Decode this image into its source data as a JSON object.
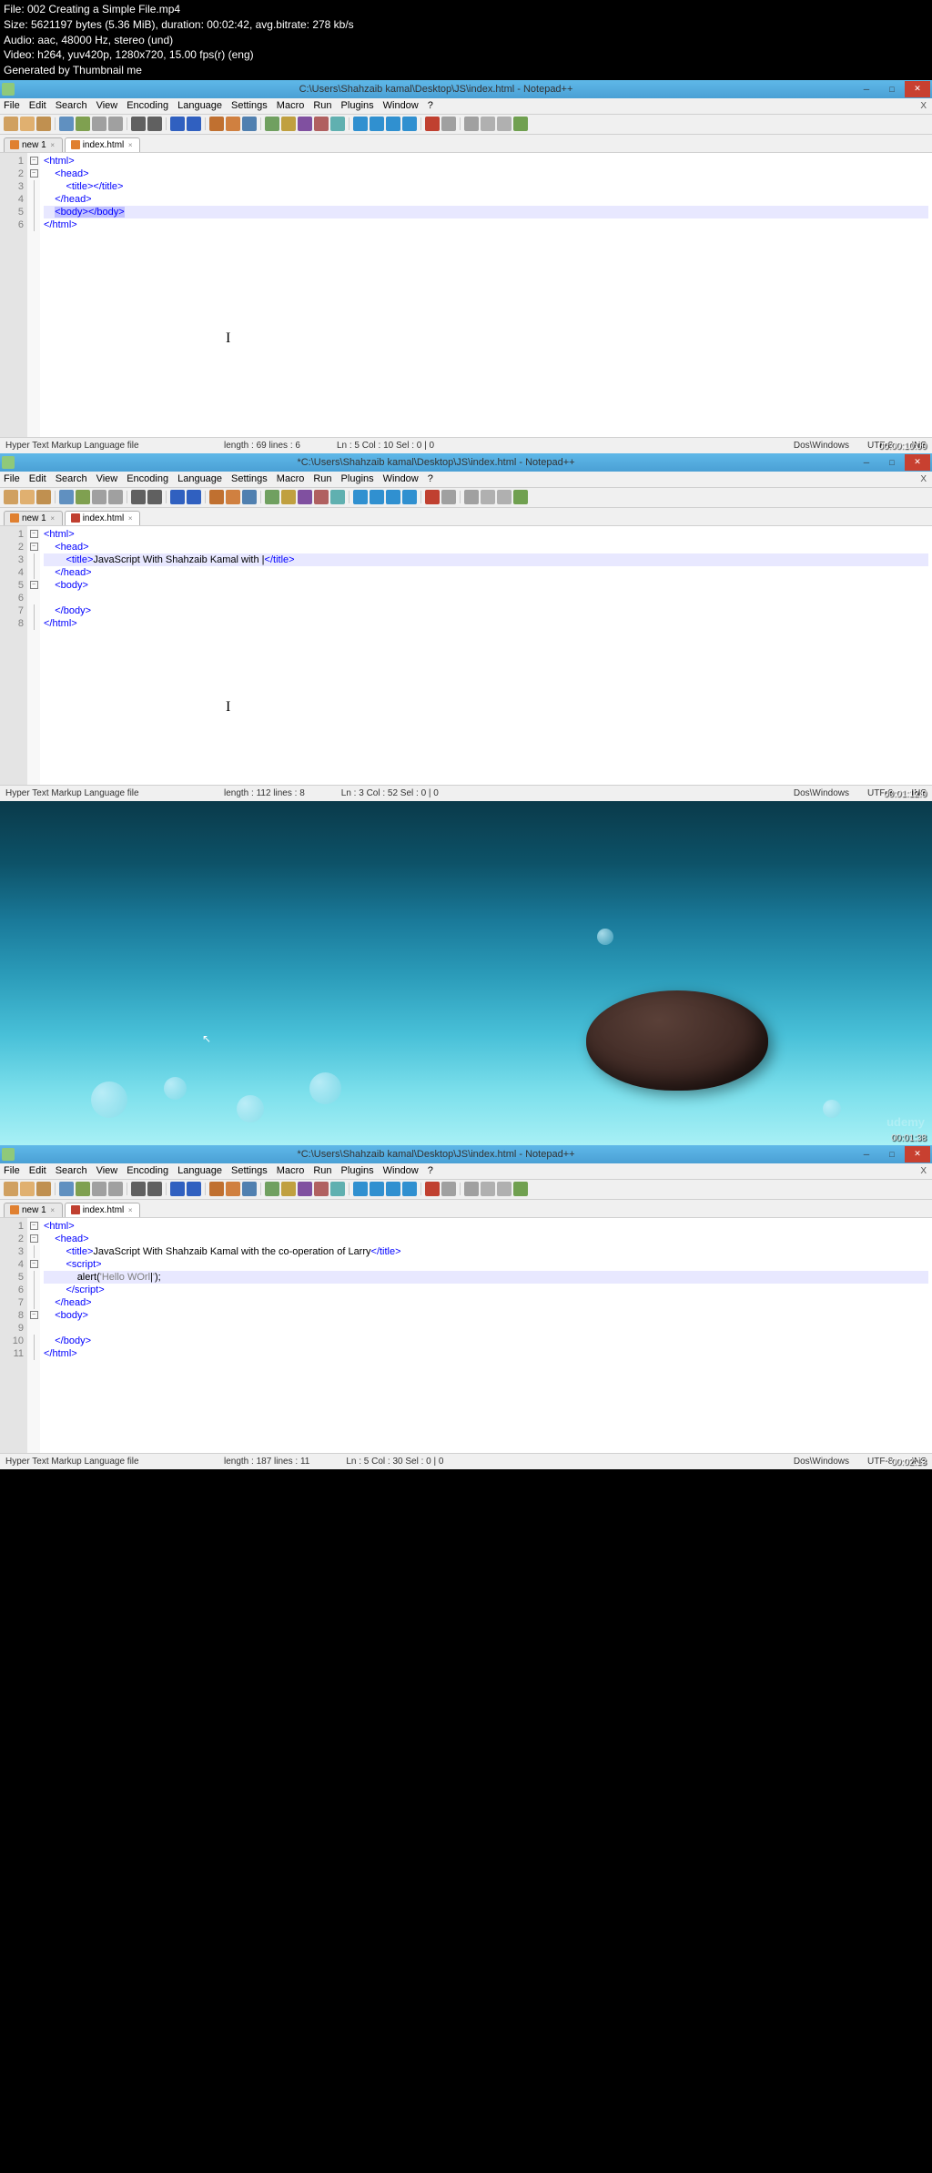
{
  "meta": {
    "file": "File: 002 Creating a Simple File.mp4",
    "size": "Size: 5621197 bytes (5.36 MiB), duration: 00:02:42, avg.bitrate: 278 kb/s",
    "audio": "Audio: aac, 48000 Hz, stereo (und)",
    "video": "Video: h264, yuv420p, 1280x720, 15.00 fps(r) (eng)",
    "gen": "Generated by Thumbnail me"
  },
  "menus": [
    "File",
    "Edit",
    "Search",
    "View",
    "Encoding",
    "Language",
    "Settings",
    "Macro",
    "Run",
    "Plugins",
    "Window",
    "?"
  ],
  "frame1": {
    "title": "C:\\Users\\Shahzaib kamal\\Desktop\\JS\\index.html - Notepad++",
    "tab_new": "new 1",
    "tab_file": "index.html",
    "code": [
      {
        "indent": 0,
        "html": "<span class='tag'>&lt;html&gt;</span>"
      },
      {
        "indent": 1,
        "html": "<span class='tag'>&lt;head&gt;</span>"
      },
      {
        "indent": 2,
        "html": "<span class='tag'>&lt;title&gt;&lt;/title&gt;</span>"
      },
      {
        "indent": 1,
        "html": "<span class='tag'>&lt;/head&gt;</span>"
      },
      {
        "indent": 1,
        "html": "<span class='tag' style='background:#c0c0ff'>&lt;body&gt;</span><span class='tag' style='background:#c0c0ff'>&lt;/body&gt;</span>",
        "hl": true
      },
      {
        "indent": 0,
        "html": "<span class='tag'>&lt;/html&gt;</span>"
      }
    ],
    "status": {
      "type": "Hyper Text Markup Language file",
      "length": "length : 69   lines : 6",
      "pos": "Ln : 5   Col : 10   Sel : 0 | 0",
      "eol": "Dos\\Windows",
      "enc": "UTF-8",
      "mode": "INS"
    },
    "timestamp": "00:00:10:00"
  },
  "frame2": {
    "title": "*C:\\Users\\Shahzaib kamal\\Desktop\\JS\\index.html - Notepad++",
    "tab_new": "new 1",
    "tab_file": "index.html",
    "code": [
      {
        "indent": 0,
        "html": "<span class='tag'>&lt;html&gt;</span>"
      },
      {
        "indent": 1,
        "html": "<span class='tag'>&lt;head&gt;</span>"
      },
      {
        "indent": 2,
        "html": "<span class='tag'>&lt;title&gt;</span><span class='txt'>JavaScript With Shahzaib Kamal with </span>|<span class='tag'>&lt;/title&gt;</span>",
        "hl": true
      },
      {
        "indent": 1,
        "html": "<span class='tag'>&lt;/head&gt;</span>"
      },
      {
        "indent": 1,
        "html": "<span class='tag'>&lt;body&gt;</span>"
      },
      {
        "indent": 0,
        "html": ""
      },
      {
        "indent": 1,
        "html": "<span class='tag'>&lt;/body&gt;</span>"
      },
      {
        "indent": 0,
        "html": "<span class='tag'>&lt;/html&gt;</span>"
      }
    ],
    "status": {
      "type": "Hyper Text Markup Language file",
      "length": "length : 112   lines : 8",
      "pos": "Ln : 3   Col : 52   Sel : 0 | 0",
      "eol": "Dos\\Windows",
      "enc": "UTF-8",
      "mode": "INS"
    },
    "timestamp": "00:01:12:0"
  },
  "frame3": {
    "watermark": "udemy",
    "timestamp": "00:01:38"
  },
  "frame4": {
    "title": "*C:\\Users\\Shahzaib kamal\\Desktop\\JS\\index.html - Notepad++",
    "tab_new": "new 1",
    "tab_file": "index.html",
    "code": [
      {
        "indent": 0,
        "html": "<span class='tag'>&lt;html&gt;</span>"
      },
      {
        "indent": 1,
        "html": "<span class='tag'>&lt;head&gt;</span>"
      },
      {
        "indent": 2,
        "html": "<span class='tag'>&lt;title&gt;</span><span class='txt'>JavaScript With Shahzaib Kamal with the co-operation of Larry</span><span class='tag'>&lt;/title&gt;</span>"
      },
      {
        "indent": 2,
        "html": "<span class='tag'>&lt;script&gt;</span>"
      },
      {
        "indent": 3,
        "html": "<span class='txt'>alert(</span><span class='str'>'Hello WOrl</span>|<span class='str'>'</span><span class='txt'>);</span>",
        "hl": true
      },
      {
        "indent": 2,
        "html": "<span class='tag'>&lt;/script&gt;</span>"
      },
      {
        "indent": 1,
        "html": "<span class='tag'>&lt;/head&gt;</span>"
      },
      {
        "indent": 1,
        "html": "<span class='tag'>&lt;body&gt;</span>"
      },
      {
        "indent": 0,
        "html": ""
      },
      {
        "indent": 1,
        "html": "<span class='tag'>&lt;/body&gt;</span>"
      },
      {
        "indent": 0,
        "html": "<span class='tag'>&lt;/html&gt;</span>"
      }
    ],
    "status": {
      "type": "Hyper Text Markup Language file",
      "length": "length : 187   lines : 11",
      "pos": "Ln : 5   Col : 30   Sel : 0 | 0",
      "eol": "Dos\\Windows",
      "enc": "UTF-8",
      "mode": "INS"
    },
    "timestamp": "00:02:13"
  },
  "toolbar_colors": [
    "#d0a060",
    "#e0b070",
    "#c09050",
    "#6090c0",
    "#7fa050",
    "#a0a0a0",
    "#a0a0a0",
    "#606060",
    "#606060",
    "#3060c0",
    "#3060c0",
    "#c07030",
    "#d08040",
    "#5080b0",
    "#70a060",
    "#c0a040",
    "#8050a0",
    "#b06060",
    "#60b0b0",
    "#3090d0",
    "#3090d0",
    "#3090d0",
    "#3090d0",
    "#c04030",
    "#a0a0a0",
    "#a0a0a0",
    "#b0b0b0",
    "#b0b0b0",
    "#70a050"
  ]
}
